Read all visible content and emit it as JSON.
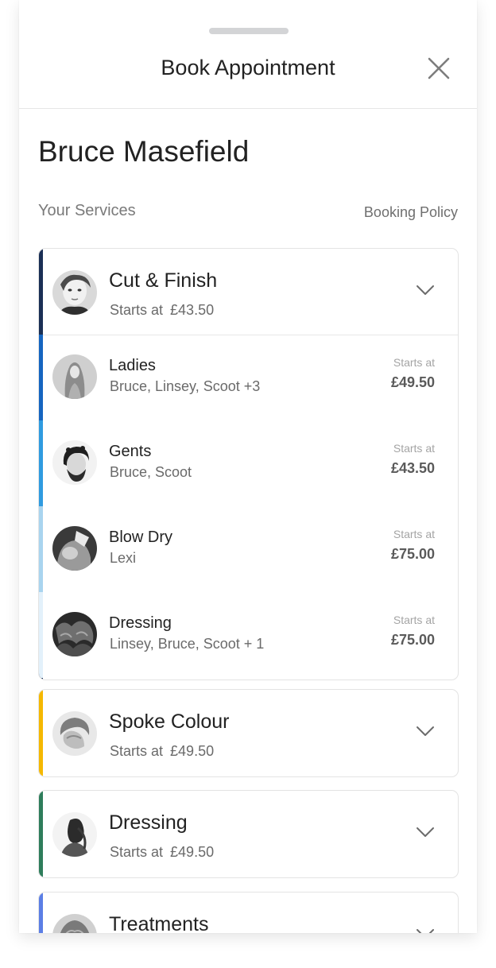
{
  "header": {
    "title": "Book Appointment",
    "close_icon": "close-icon"
  },
  "provider": {
    "name": "Bruce Masefield"
  },
  "services_section": {
    "label": "Your Services",
    "policy_link": "Booking Policy"
  },
  "categories": [
    {
      "title": "Cut & Finish",
      "starts_label": "Starts at",
      "price": "£43.50",
      "accent": "#1a2f55",
      "expanded": true,
      "icon": "chevron-down-icon",
      "services": [
        {
          "name": "Ladies",
          "staff": "Bruce, Linsey, Scoot +3",
          "starts_label": "Starts at",
          "price": "£49.50",
          "accent": "#1565c0"
        },
        {
          "name": "Gents",
          "staff": "Bruce, Scoot",
          "starts_label": "Starts at",
          "price": "£43.50",
          "accent": "#2f9be0"
        },
        {
          "name": "Blow Dry",
          "staff": "Lexi",
          "starts_label": "Starts at",
          "price": "£75.00",
          "accent": "#a9d4ef"
        },
        {
          "name": "Dressing",
          "staff": "Linsey, Bruce, Scoot + 1",
          "starts_label": "Starts at",
          "price": "£75.00",
          "accent": "#e3f1fb"
        }
      ]
    },
    {
      "title": "Spoke Colour",
      "starts_label": "Starts at",
      "price": "£49.50",
      "accent": "#f5b800",
      "expanded": false,
      "icon": "chevron-down-icon"
    },
    {
      "title": "Dressing",
      "starts_label": "Starts at",
      "price": "£49.50",
      "accent": "#2e7d5b",
      "expanded": false,
      "icon": "chevron-down-icon"
    },
    {
      "title": "Treatments",
      "accent": "#5b7ee5",
      "expanded": false,
      "icon": "chevron-down-icon"
    }
  ]
}
